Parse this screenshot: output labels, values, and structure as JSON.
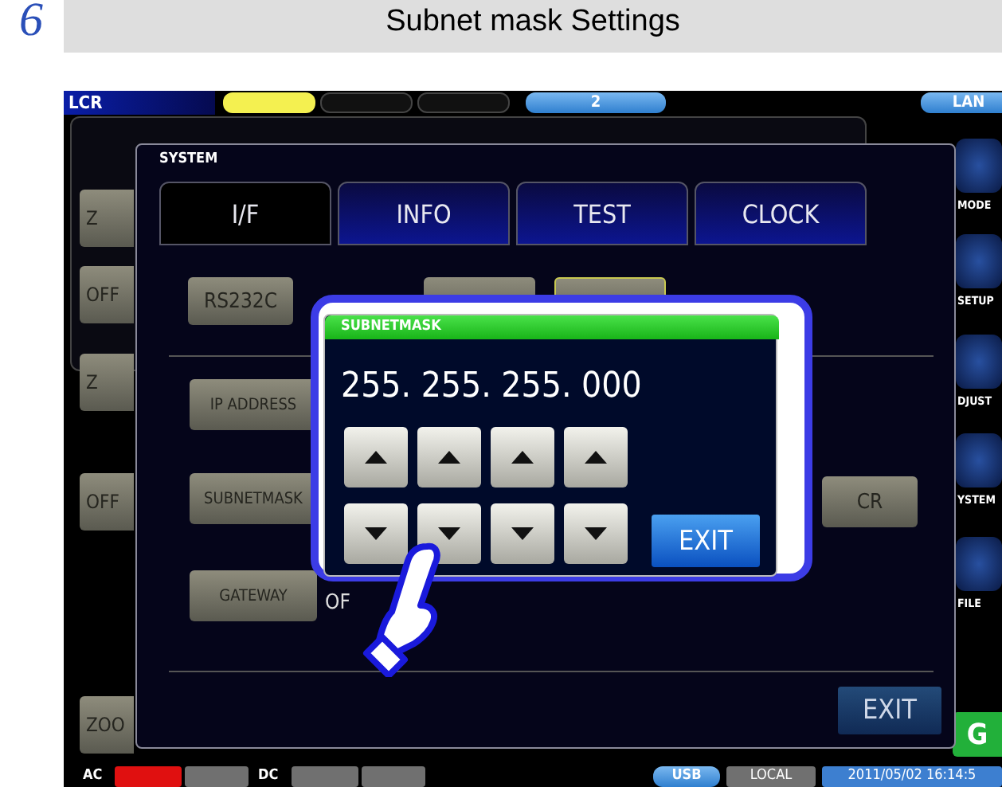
{
  "step": "6",
  "heading": "Subnet mask Settings",
  "screen": {
    "top_bar": {
      "mode": "LCR",
      "range": "2",
      "interface": "LAN"
    },
    "left_buttons": [
      {
        "label": "Z"
      },
      {
        "label": "OFF"
      },
      {
        "label": "Z"
      },
      {
        "label": "OFF"
      },
      {
        "label": "ZOO"
      }
    ],
    "right_menu": [
      {
        "label": "MODE"
      },
      {
        "label": "SETUP"
      },
      {
        "label": "DJUST"
      },
      {
        "label": "YSTEM"
      },
      {
        "label": "FILE"
      }
    ],
    "side_button": "G",
    "system_panel": {
      "title": "SYSTEM",
      "tabs": [
        {
          "label": "I/F",
          "selected": true
        },
        {
          "label": "INFO",
          "selected": false
        },
        {
          "label": "TEST",
          "selected": false
        },
        {
          "label": "CLOCK",
          "selected": false
        }
      ],
      "interface_button": "RS232C",
      "settings": [
        {
          "label": "IP ADDRESS"
        },
        {
          "label": "SUBNETMASK"
        },
        {
          "label": "GATEWAY",
          "value": "OF"
        }
      ],
      "cr_button": "CR",
      "exit": "EXIT"
    },
    "dialog": {
      "title": "SUBNETMASK",
      "value": "255. 255. 255. 000",
      "exit": "EXIT"
    },
    "status_bar": {
      "ac": "AC",
      "dc": "DC",
      "usb": "USB",
      "local": "LOCAL",
      "datetime": "2011/05/02 16:14:5"
    }
  }
}
